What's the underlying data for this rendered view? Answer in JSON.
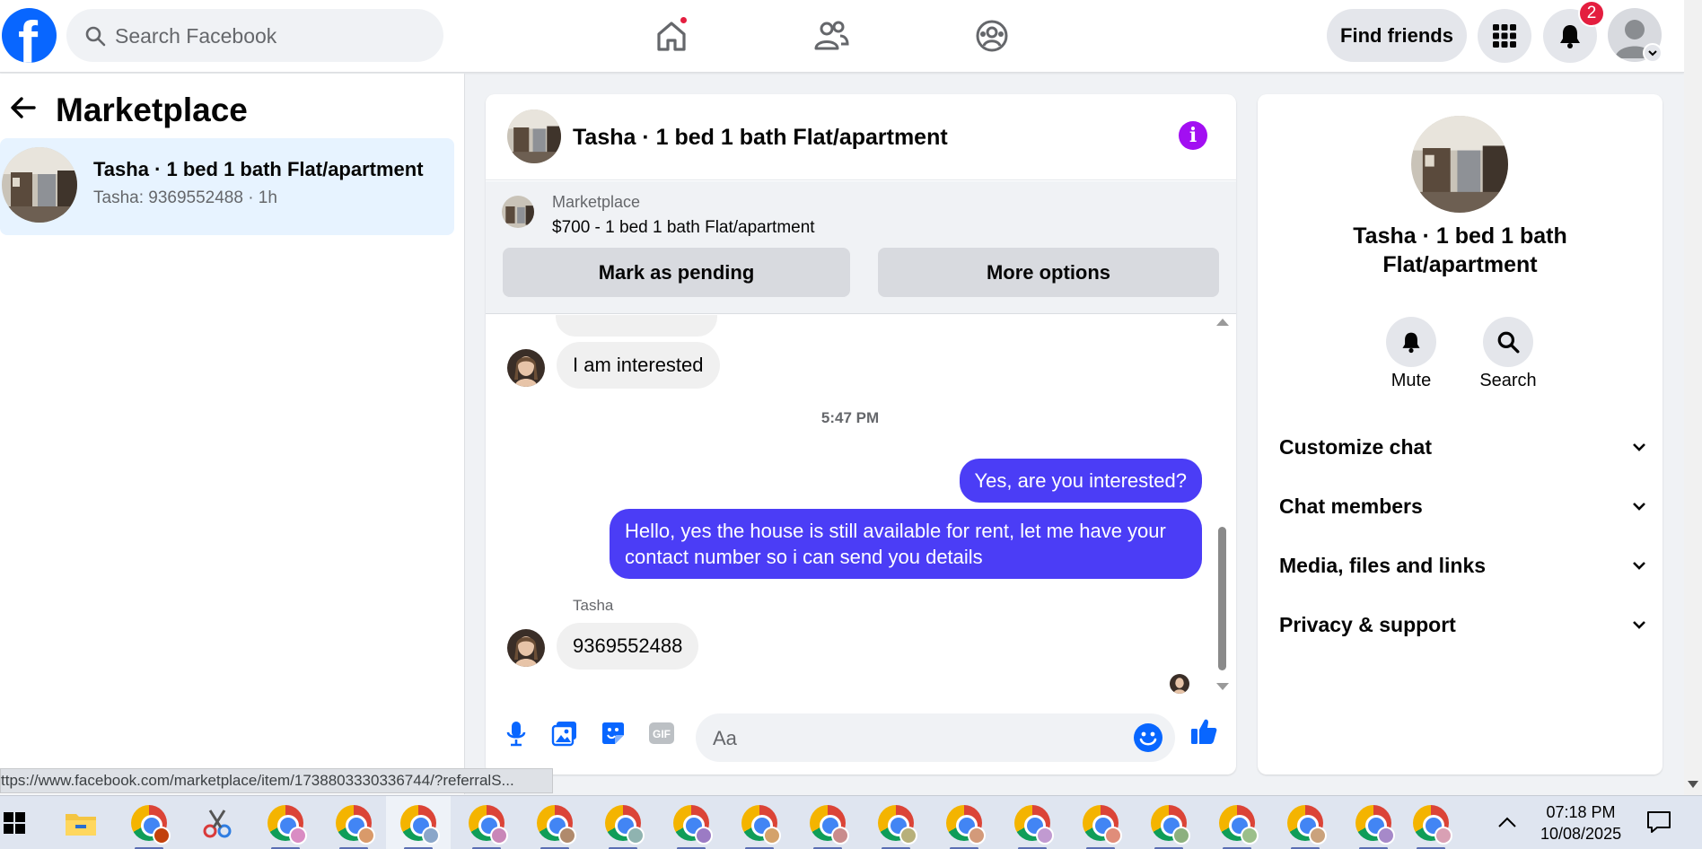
{
  "topbar": {
    "logo_letter": "f",
    "search_placeholder": "Search Facebook",
    "find_friends": "Find friends",
    "notifications_count": "2"
  },
  "left": {
    "title": "Marketplace",
    "conversation": {
      "title": "Tasha · 1 bed 1 bath Flat/apartment",
      "subtitle": "Tasha: 9369552488 · 1h"
    }
  },
  "chat": {
    "header_name": "Tasha · 1 bed 1 bath Flat/apartment",
    "info_glyph": "i",
    "marketplace_label": "Marketplace",
    "listing_price": "$700 - 1 bed 1 bath Flat/apartment",
    "mark_pending": "Mark as pending",
    "more_options": "More options",
    "messages": {
      "in_1": "I am interested",
      "time": "5:47 PM",
      "out_1": "Yes, are you interested?",
      "out_2": "Hello, yes the house is still available for rent, let me have your contact number so i can send you details",
      "sender": "Tasha",
      "in_2": "9369552488"
    },
    "composer_placeholder": "Aa"
  },
  "right": {
    "name": "Tasha · 1 bed 1 bath Flat/apartment",
    "mute": "Mute",
    "search": "Search",
    "rows": [
      "Customize chat",
      "Chat members",
      "Media, files and links",
      "Privacy & support"
    ]
  },
  "status_url": "ttps://www.facebook.com/marketplace/item/1738803330336744/?referralS...",
  "taskbar": {
    "time": "07:18 PM",
    "date": "10/08/2025"
  },
  "colors": {
    "brand": "#0866ff",
    "outgoing_bubble": "#4b3df6",
    "info_purple": "#a20ff2",
    "badge_red": "#e41e3f"
  }
}
